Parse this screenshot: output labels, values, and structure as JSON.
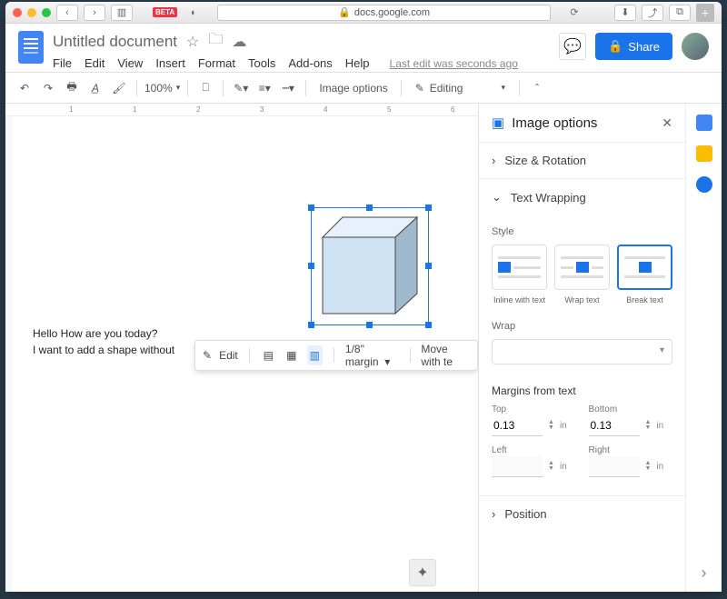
{
  "browser": {
    "url": "docs.google.com",
    "beta": "BETA"
  },
  "doc": {
    "title": "Untitled document",
    "menu": [
      "File",
      "Edit",
      "View",
      "Insert",
      "Format",
      "Tools",
      "Add-ons",
      "Help"
    ],
    "last_edit": "Last edit was seconds ago",
    "share": "Share"
  },
  "toolbar": {
    "zoom": "100%",
    "image_options": "Image options",
    "editing": "Editing"
  },
  "page_text": {
    "line1": "Hello How are you today?",
    "line2": "I want to add a shape without"
  },
  "float": {
    "edit": "Edit",
    "margin": "1/8\" margin",
    "move": "Move with te"
  },
  "panel": {
    "title": "Image options",
    "size_rotation": "Size & Rotation",
    "text_wrapping": "Text Wrapping",
    "style": "Style",
    "inline": "Inline with text",
    "wrap": "Wrap text",
    "break": "Break text",
    "wrap_label": "Wrap",
    "margins_from_text": "Margins from text",
    "top": "Top",
    "bottom": "Bottom",
    "left": "Left",
    "right": "Right",
    "top_val": "0.13",
    "bottom_val": "0.13",
    "unit": "in",
    "position": "Position"
  }
}
